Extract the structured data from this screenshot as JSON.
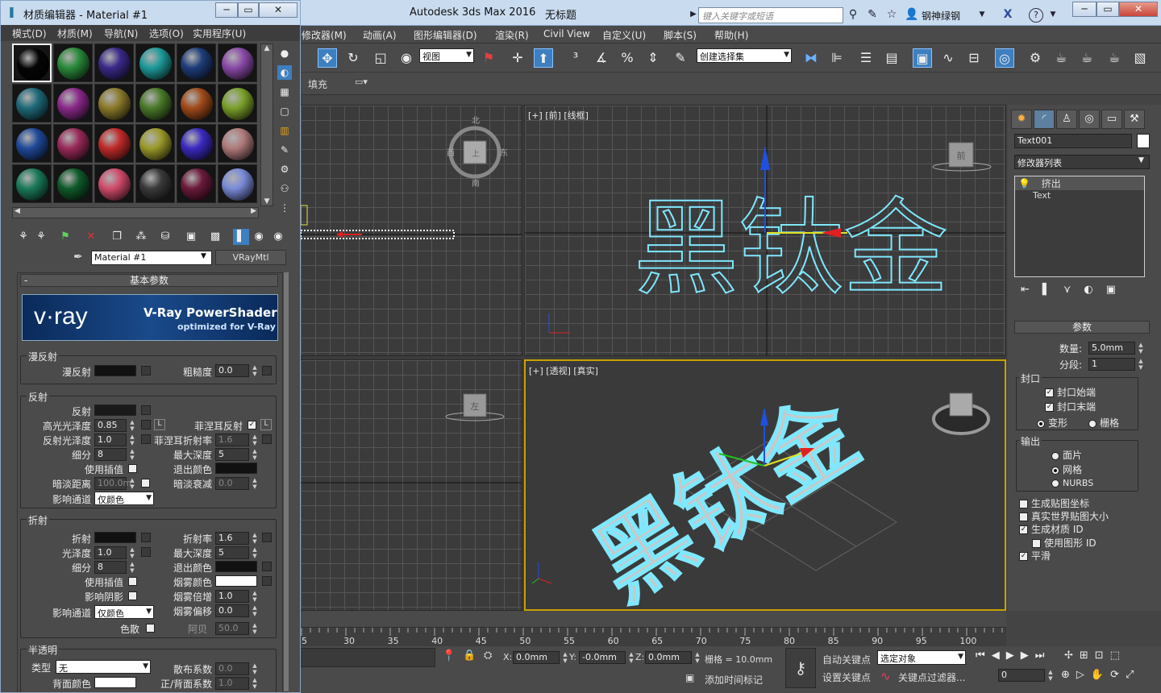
{
  "main_window": {
    "app_title": "Autodesk 3ds Max 2016",
    "doc_title": "无标题",
    "search_placeholder": "键入关键字或短语",
    "user_name": "钢神绿钢",
    "menu": [
      "修改器(M)",
      "动画(A)",
      "图形编辑器(D)",
      "渲染(R)",
      "Civil View",
      "自定义(U)",
      "脚本(S)",
      "帮助(H)"
    ],
    "ref_coord": "视图",
    "named_selection": "创建选择集",
    "ribbon_fill": "填充"
  },
  "viewports": {
    "top_label": "",
    "front_label": "[+] [前] [线框]",
    "left_label": "",
    "persp_label": "[+] [透视] [真实]",
    "viewcube_top": {
      "n": "北",
      "s": "南",
      "e": "东",
      "w": "西",
      "center": "上"
    },
    "viewcube_front": "前",
    "viewcube_left": "左",
    "text_3d": "黑钛金"
  },
  "command_panel": {
    "object_name": "Text001",
    "modifier_list": "修改器列表",
    "stack": [
      "挤出",
      "Text"
    ],
    "params_title": "参数",
    "amount_label": "数量:",
    "amount_value": "5.0mm",
    "segments_label": "分段:",
    "segments_value": "1",
    "capping_title": "封口",
    "cap_start": "封口始端",
    "cap_end": "封口末端",
    "morph": "变形",
    "grid": "栅格",
    "output_title": "输出",
    "patch": "面片",
    "mesh": "网格",
    "nurbs": "NURBS",
    "gen_map": "生成贴图坐标",
    "real_world": "真实世界贴图大小",
    "gen_mat_id": "生成材质 ID",
    "use_shape_id": "使用图形 ID",
    "smooth": "平滑"
  },
  "timeline": {
    "ticks": [
      "5",
      "30",
      "35",
      "40",
      "45",
      "50",
      "55",
      "60",
      "65",
      "70",
      "75",
      "80",
      "85",
      "90",
      "95",
      "100"
    ]
  },
  "status": {
    "x_label": "X:",
    "x_value": "0.0mm",
    "y_label": "Y:",
    "y_value": "-0.0mm",
    "z_label": "Z:",
    "z_value": "0.0mm",
    "grid": "栅格 = 10.0mm",
    "auto_key": "自动关键点",
    "set_key": "设置关键点",
    "selected": "选定对象",
    "key_filters": "关键点过滤器...",
    "add_time_tag": "添加时间标记",
    "frame": "0"
  },
  "mat_editor": {
    "title": "材质编辑器 - Material #1",
    "menu": [
      "模式(D)",
      "材质(M)",
      "导航(N)",
      "选项(O)",
      "实用程序(U)"
    ],
    "material_name": "Material #1",
    "material_type": "VRayMtl",
    "rollout_basic": "基本参数",
    "vray_logo": "v·ray",
    "vray_title": "V-Ray PowerShader",
    "vray_sub": "optimized for V-Ray",
    "slot_colors": [
      "#050505",
      "#2a8a3a",
      "#3b2a8a",
      "#1f9a9a",
      "#1e3d7a",
      "#8a4aa8",
      "#1f6a7a",
      "#8a2a8a",
      "#8a7a2a",
      "#4a7a2a",
      "#a04a1a",
      "#7aa02a",
      "#1f4a9a",
      "#9a2a5a",
      "#c02a2a",
      "#9a9a2a",
      "#3a2ac0",
      "#b07a7a",
      "#1a7a5a",
      "#0f5a2a",
      "#d04a6a",
      "#3a3a3a",
      "#6a1a3a",
      "#7a8ad8"
    ],
    "diffuse_group": "漫反射",
    "diffuse": "漫反射",
    "roughness": "粗糙度",
    "roughness_value": "0.0",
    "reflect_group": "反射",
    "reflect": "反射",
    "hilight_gloss": "高光光泽度",
    "hilight_gloss_value": "0.85",
    "fresnel": "菲涅耳反射",
    "refl_gloss": "反射光泽度",
    "refl_gloss_value": "1.0",
    "fresnel_ior": "菲涅耳折射率",
    "fresnel_ior_value": "1.6",
    "subdivs": "细分",
    "subdivs_value": "8",
    "max_depth": "最大深度",
    "max_depth_value": "5",
    "use_interp": "使用插值",
    "exit_color": "退出颜色",
    "dim_dist": "暗淡距离",
    "dim_dist_value": "100.0m",
    "dim_falloff": "暗淡衰减",
    "dim_falloff_value": "0.0",
    "affect_channels": "影响通道",
    "color_only": "仅颜色",
    "refract_group": "折射",
    "refract": "折射",
    "ior": "折射率",
    "ior_value": "1.6",
    "gloss": "光泽度",
    "gloss_value": "1.0",
    "r_max_depth_value": "5",
    "r_subdivs_value": "8",
    "affect_shadows": "影响阴影",
    "fog_color": "烟雾颜色",
    "fog_mult": "烟雾倍增",
    "fog_mult_value": "1.0",
    "fog_bias": "烟雾偏移",
    "fog_bias_value": "0.0",
    "dispersion": "色散",
    "abbe": "阿贝",
    "abbe_value": "50.0",
    "translucency_group": "半透明",
    "type": "类型",
    "type_value": "无",
    "scatter_coef": "散布系数",
    "scatter_value": "0.0",
    "back_color": "背面颜色",
    "fwd_bck": "正/背面系数",
    "fwd_bck_value": "1.0",
    "L": "L"
  }
}
